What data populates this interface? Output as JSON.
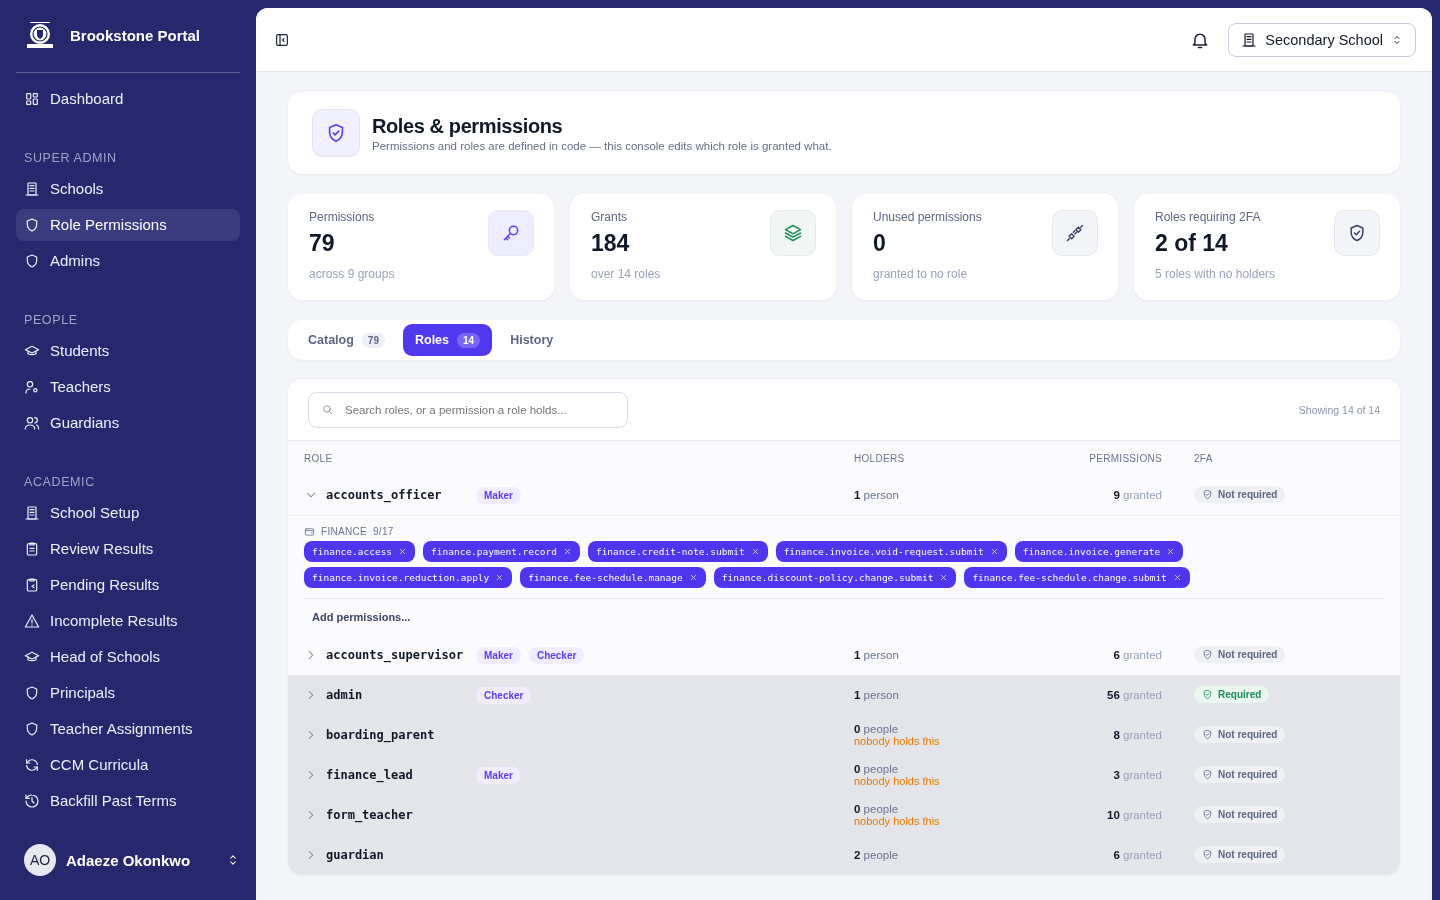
{
  "brand": {
    "name": "Brookstone Portal"
  },
  "sidebar": {
    "sections": [
      {
        "items": [
          {
            "label": "Dashboard",
            "selected": false
          }
        ]
      },
      {
        "heading": "SUPER ADMIN",
        "items": [
          {
            "label": "Schools",
            "selected": false
          },
          {
            "label": "Role Permissions",
            "selected": true
          },
          {
            "label": "Admins",
            "selected": false
          }
        ]
      },
      {
        "heading": "PEOPLE",
        "items": [
          {
            "label": "Students",
            "selected": false
          },
          {
            "label": "Teachers",
            "selected": false
          },
          {
            "label": "Guardians",
            "selected": false
          }
        ]
      },
      {
        "heading": "ACADEMIC",
        "items": [
          {
            "label": "School Setup",
            "selected": false
          },
          {
            "label": "Review Results",
            "selected": false
          },
          {
            "label": "Pending Results",
            "selected": false
          },
          {
            "label": "Incomplete Results",
            "selected": false
          },
          {
            "label": "Head of Schools",
            "selected": false
          },
          {
            "label": "Principals",
            "selected": false
          },
          {
            "label": "Teacher Assignments",
            "selected": false
          },
          {
            "label": "CCM Curricula",
            "selected": false
          },
          {
            "label": "Backfill Past Terms",
            "selected": false
          }
        ]
      }
    ],
    "user": {
      "initials": "AO",
      "name": "Adaeze Okonkwo"
    }
  },
  "topbar": {
    "school_selector": "Secondary School"
  },
  "header": {
    "title": "Roles & permissions",
    "subtitle": "Permissions and roles are defined in code — this console edits which role is granted what."
  },
  "stats": [
    {
      "label": "Permissions",
      "value": "79",
      "note": "across 9 groups"
    },
    {
      "label": "Grants",
      "value": "184",
      "note": "over 14 roles"
    },
    {
      "label": "Unused permissions",
      "value": "0",
      "note": "granted to no role"
    },
    {
      "label": "Roles requiring 2FA",
      "value": "2 of 14",
      "note": "5 roles with no holders"
    }
  ],
  "tabs": [
    {
      "label": "Catalog",
      "count": "79",
      "selected": false
    },
    {
      "label": "Roles",
      "count": "14",
      "selected": true
    },
    {
      "label": "History",
      "selected": false
    }
  ],
  "table": {
    "search": {
      "placeholder": "Search roles, or a permission a role holds..."
    },
    "showing": "Showing 14 of 14",
    "columns": [
      "ROLE",
      "HOLDERS",
      "PERMISSIONS",
      "2FA"
    ],
    "rows": [
      {
        "role": "accounts_officer",
        "badges": [
          "Maker"
        ],
        "holders": "1",
        "holders_unit": "person",
        "permissions": "9",
        "permissions_unit": "granted",
        "twofa": "Not required",
        "required": false,
        "expanded": true,
        "shaded": false,
        "group": {
          "name": "FINANCE",
          "count": "9/17",
          "permissions": [
            "finance.access",
            "finance.payment.record",
            "finance.credit-note.submit",
            "finance.invoice.void-request.submit",
            "finance.invoice.generate",
            "finance.invoice.reduction.apply",
            "finance.fee-schedule.manage",
            "finance.discount-policy.change.submit",
            "finance.fee-schedule.change.submit"
          ]
        },
        "add_label": "Add permissions..."
      },
      {
        "role": "accounts_supervisor",
        "badges": [
          "Maker",
          "Checker"
        ],
        "holders": "1",
        "holders_unit": "person",
        "permissions": "6",
        "permissions_unit": "granted",
        "twofa": "Not required",
        "required": false,
        "expanded": false,
        "shaded": false
      },
      {
        "role": "admin",
        "badges": [
          "Checker"
        ],
        "holders": "1",
        "holders_unit": "person",
        "permissions": "56",
        "permissions_unit": "granted",
        "twofa": "Required",
        "required": true,
        "expanded": false,
        "shaded": true
      },
      {
        "role": "boarding_parent",
        "badges": [],
        "holders": "0",
        "holders_unit": "people",
        "warning": "nobody holds this",
        "permissions": "8",
        "permissions_unit": "granted",
        "twofa": "Not required",
        "required": false,
        "expanded": false,
        "shaded": true
      },
      {
        "role": "finance_lead",
        "badges": [
          "Maker"
        ],
        "holders": "0",
        "holders_unit": "people",
        "warning": "nobody holds this",
        "permissions": "3",
        "permissions_unit": "granted",
        "twofa": "Not required",
        "required": false,
        "expanded": false,
        "shaded": true
      },
      {
        "role": "form_teacher",
        "badges": [],
        "holders": "0",
        "holders_unit": "people",
        "warning": "nobody holds this",
        "permissions": "10",
        "permissions_unit": "granted",
        "twofa": "Not required",
        "required": false,
        "expanded": false,
        "shaded": true
      },
      {
        "role": "guardian",
        "badges": [],
        "holders": "2",
        "holders_unit": "people",
        "permissions": "6",
        "permissions_unit": "granted",
        "twofa": "Not required",
        "required": false,
        "expanded": false,
        "shaded": true
      }
    ]
  }
}
